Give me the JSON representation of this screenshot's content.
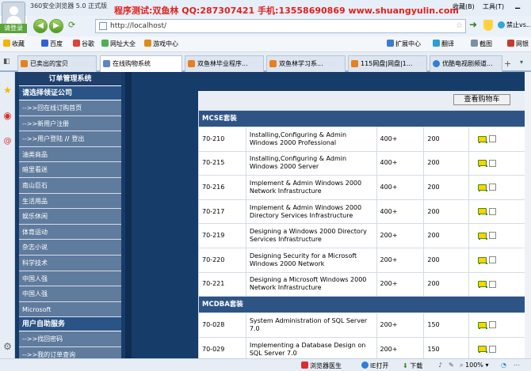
{
  "titlebar": {
    "app_title": "360安全浏览器 5.0 正式版",
    "watermark": "程序测试:双鱼林 QQ:287307421 手机:13558690869 www.shuangyulin.com",
    "menu_favorites": "收藏(B)",
    "menu_tools": "工具(T)",
    "login_label": "请登录"
  },
  "navbar": {
    "address": "http://localhost/",
    "search_label": "禁止vs..."
  },
  "favbar": {
    "items": [
      "收藏",
      "百度",
      "谷歌",
      "网址大全",
      "游戏中心"
    ],
    "right_items": [
      "扩展中心",
      "翻译",
      "截图",
      "网银"
    ]
  },
  "tabs": [
    {
      "label": "已卖出的宝贝",
      "active": false
    },
    {
      "label": "在线购物系统",
      "active": true
    },
    {
      "label": "双鱼林毕业程序...",
      "active": false
    },
    {
      "label": "双鱼林学习系...",
      "active": false
    },
    {
      "label": "115网盘|网盘|1...",
      "active": false
    },
    {
      "label": "优酷电视剧频道...",
      "active": false
    }
  ],
  "sidebar": {
    "header": "订单管理系统",
    "section1": "请选择领证公司",
    "items1": [
      "-->>回在线订购首页",
      "-->>新用户注册"
    ],
    "login_item": "-->>用户登陆",
    "logout_item": "登出",
    "categories": [
      "油类商品",
      "暗里看迷",
      "南山巨石",
      "生活用品",
      "娱乐休闲",
      "体育运动",
      "杂志小说",
      "科学技术",
      "中国人强",
      "中国人强",
      "Microsoft"
    ],
    "section2": "用户自助服务",
    "items2": [
      "-->>找回密码",
      "-->>我的订单查询"
    ]
  },
  "content": {
    "cart_button": "查看购物车",
    "sections": [
      {
        "title": "MCSE套装",
        "rows": [
          {
            "code": "70-210",
            "name": "Installing,Configuring & Admin Windows 2000 Professional",
            "price": "400+",
            "stock": "200"
          },
          {
            "code": "70-215",
            "name": "Installing,Configuring & Admin Windows 2000 Server",
            "price": "400+",
            "stock": "200"
          },
          {
            "code": "70-216",
            "name": "Implement & Admin Windows 2000 Network Infrastructure",
            "price": "400+",
            "stock": "200"
          },
          {
            "code": "70-217",
            "name": "Implement & Admin Windows 2000 Directory Services Infrastructure",
            "price": "400+",
            "stock": "200"
          },
          {
            "code": "70-219",
            "name": "Designing a Windows 2000 Directory Services Infrastructure",
            "price": "200+",
            "stock": "200"
          },
          {
            "code": "70-220",
            "name": "Designing Security for a Microsoft Windows 2000 Network",
            "price": "200+",
            "stock": "200"
          },
          {
            "code": "70-221",
            "name": "Designing a Microsoft Windows 2000 Network Infrastructure",
            "price": "200+",
            "stock": "200"
          }
        ]
      },
      {
        "title": "MCDBA套装",
        "rows": [
          {
            "code": "70-028",
            "name": "System Administration of SQL Server 7.0",
            "price": "200+",
            "stock": "150"
          },
          {
            "code": "70-029",
            "name": "Implementing a Database Design on SQL Server 7.0",
            "price": "200+",
            "stock": "150"
          }
        ]
      }
    ]
  },
  "statusbar": {
    "doctor": "浏览器医生",
    "ie_open": "IE打开",
    "download": "下载",
    "zoom": "100%"
  },
  "colors": {
    "menu_header": "#1f3f6c",
    "section_bar": "#2d5485",
    "watermark": "#e0211b",
    "page_bg": "#163c6a"
  }
}
